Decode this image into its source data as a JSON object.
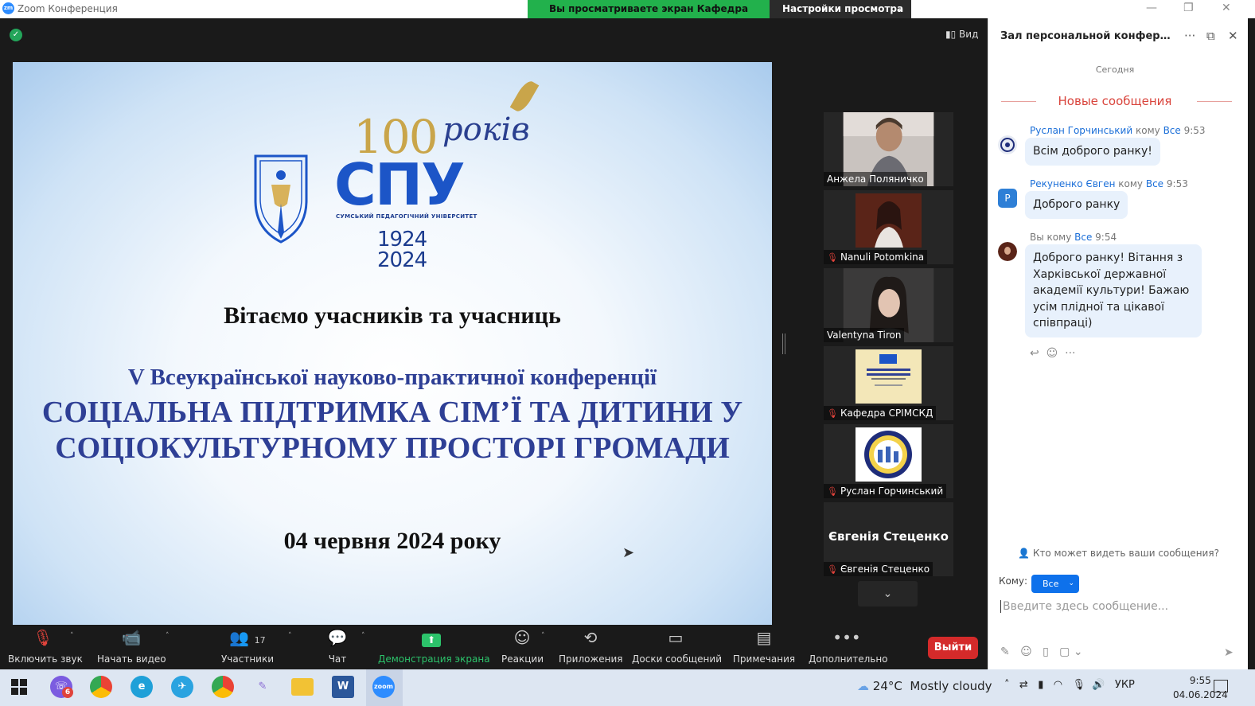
{
  "window": {
    "title": "Zoom Конференция",
    "logo_text": "zm"
  },
  "share_banner": {
    "text": "Вы просматриваете экран Кафедра СРІМСКД",
    "view_settings": "Настройки просмотра"
  },
  "meeting": {
    "view_label": "Вид"
  },
  "slide": {
    "hundred": "100",
    "rokiv": "років",
    "logo": "СПУ",
    "university": "СУМСЬКИЙ ПЕДАГОГІЧНИЙ УНІВЕРСИТЕТ",
    "years_top": "1924",
    "years_bottom": "2024",
    "greeting": "Вітаємо учасників та учасниць",
    "conference": "V Всеукраїнської науково-практичної конференції",
    "theme_line1": "СОЦІАЛЬНА ПІДТРИМКА СІМ’Ї ТА ДИТИНИ У",
    "theme_line2": "СОЦІОКУЛЬТУРНОМУ ПРОСТОРІ ГРОМАДИ",
    "date": "04 червня 2024 року"
  },
  "participants": [
    {
      "name": "Анжела Поляничко",
      "muted": false
    },
    {
      "name": "Nanuli Potomkina",
      "muted": true
    },
    {
      "name": "Valentyna Tiron",
      "muted": false
    },
    {
      "name": "Кафедра СРІМСКД",
      "muted": true
    },
    {
      "name": "Руслан Горчинський",
      "muted": true
    },
    {
      "name": "Євгенія Стеценко",
      "muted": true,
      "display_name": "Євгенія Стеценко"
    }
  ],
  "toolbar": {
    "unmute": "Включить звук",
    "start_video": "Начать видео",
    "participants": "Участники",
    "participants_count": "17",
    "chat": "Чат",
    "share": "Демонстрация экрана",
    "reactions": "Реакции",
    "apps": "Приложения",
    "whiteboards": "Доски сообщений",
    "notes": "Примечания",
    "more": "Дополнительно",
    "leave": "Выйти"
  },
  "chat": {
    "title": "Зал персональной конференци...",
    "today": "Сегодня",
    "new_messages": "Новые сообщения",
    "messages": [
      {
        "from": "Руслан Горчинський",
        "to_word": "кому",
        "to": "Все",
        "time": "9:53",
        "text": "Всім доброго ранку!"
      },
      {
        "from": "Рекуненко Євген",
        "to_word": "кому",
        "to": "Все",
        "time": "9:53",
        "text": "Доброго ранку",
        "avatar_letter": "Р"
      },
      {
        "from": "Вы",
        "to_word": "кому",
        "to": "Все",
        "time": "9:54",
        "text_lines": [
          "Доброго ранку! Вітання з",
          "Харківської державної",
          "академії культури! Бажаю",
          "усім плідної та цікавої",
          "співпраці)"
        ]
      }
    ],
    "who_sees": "Кто может видеть ваши сообщения?",
    "to_label": "Кому:",
    "to_value": "Все",
    "input_placeholder": "Введите здесь сообщение..."
  },
  "taskbar": {
    "viber_badge": "6",
    "temperature": "24°C",
    "weather": "Mostly cloudy",
    "language": "УКР",
    "time": "9:55",
    "date": "04.06.2024"
  },
  "colors": {
    "share_green": "#22b14c",
    "leave_red": "#d42a2a",
    "chat_link": "#1a6ed8",
    "new_msgs_red": "#d9443c"
  }
}
